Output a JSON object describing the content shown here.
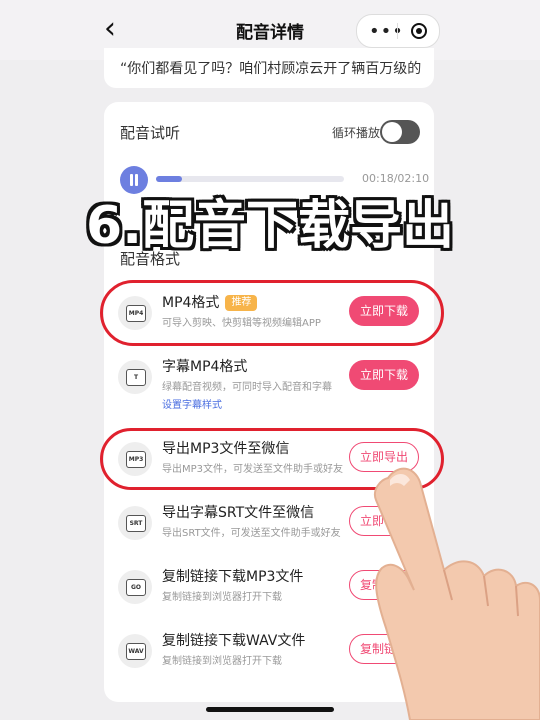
{
  "header": {
    "back_icon": "chevron-left-icon",
    "title": "配音详情",
    "more_icon": "more-dots-icon",
    "close_icon": "target-icon"
  },
  "script_preview": "“你们都看见了吗？咱们村顾凉云开了辆百万级的",
  "preview": {
    "title": "配音试听",
    "loop_label": "循环播放",
    "loop_on": false,
    "play_state": "playing",
    "time": "00:18/02:10",
    "progress_fraction": 0.138
  },
  "overlay_caption": "6.配音下载导出",
  "format_section": {
    "title": "配音格式",
    "items": [
      {
        "icon": "mp4-file-icon",
        "icon_text": "MP4",
        "name": "MP4格式",
        "badge": "推荐",
        "desc": "可导入剪映、快剪辑等视频编辑APP",
        "action": "立即下载",
        "style": "filled"
      },
      {
        "icon": "subtitle-mp4-icon",
        "icon_text": "T",
        "name": "字幕MP4格式",
        "desc": "绿幕配音视频，可同时导入配音和字幕",
        "link": "设置字幕样式",
        "action": "立即下载",
        "style": "filled"
      },
      {
        "icon": "mp3-file-icon",
        "icon_text": "MP3",
        "name": "导出MP3文件至微信",
        "desc": "导出MP3文件，可发送至文件助手或好友",
        "action": "立即导出",
        "style": "outline"
      },
      {
        "icon": "srt-file-icon",
        "icon_text": "SRT",
        "name": "导出字幕SRT文件至微信",
        "desc": "导出SRT文件，可发送至文件助手或好友",
        "action": "立即导出",
        "style": "outline"
      },
      {
        "icon": "link-icon",
        "icon_text": "GO",
        "name": "复制链接下载MP3文件",
        "desc": "复制链接到浏览器打开下载",
        "action": "复制链接",
        "style": "outline"
      },
      {
        "icon": "wav-file-icon",
        "icon_text": "WAV",
        "name": "复制链接下载WAV文件",
        "desc": "复制链接到浏览器打开下载",
        "action": "复制链接",
        "style": "outline"
      }
    ]
  },
  "colors": {
    "accent": "#f04a74",
    "progress": "#6d7fe0",
    "highlight_ring": "#e0212e",
    "badge": "#f7b44a"
  }
}
